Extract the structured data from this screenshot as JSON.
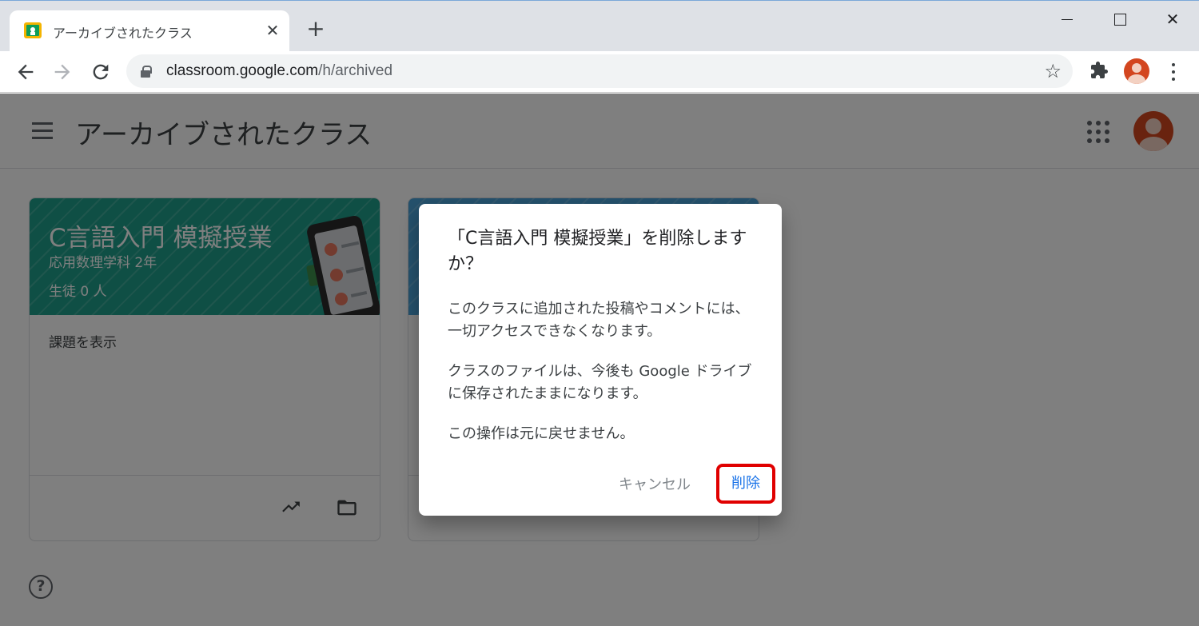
{
  "browser": {
    "tab_title": "アーカイブされたクラス",
    "tab_close": "✕",
    "new_tab": "+",
    "url_host": "classroom.google.com",
    "url_path": "/h/archived",
    "window_close": "✕"
  },
  "header": {
    "title": "アーカイブされたクラス"
  },
  "classes": [
    {
      "title": "C言語入門 模擬授業",
      "section": "応用数理学科 2年",
      "students": "生徒 0 人",
      "link": "課題を表示",
      "banner_color": "#1e9e8a"
    },
    {
      "banner_color": "#4aa3d8"
    }
  ],
  "help": {
    "label": "?"
  },
  "dialog": {
    "title": "「C言語入門 模擬授業」を削除しますか？",
    "body_1": "このクラスに追加された投稿やコメントには、一切アクセスできなくなります。",
    "body_2": "クラスのファイルは、今後も Google ドライブに保存されたままになります。",
    "body_3": "この操作は元に戻せません。",
    "cancel_label": "キャンセル",
    "delete_label": "削除",
    "highlight_color": "#e00000"
  }
}
